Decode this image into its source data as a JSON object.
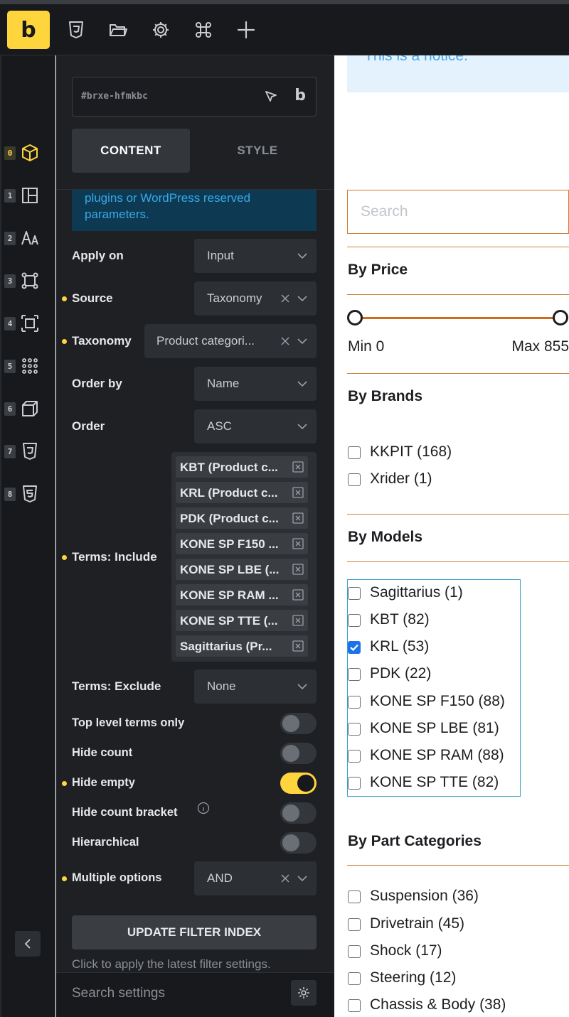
{
  "toolbar": {
    "brand_letter": "b",
    "icons": [
      "css3-icon",
      "folder-icon",
      "gear-icon",
      "command-icon",
      "plus-icon"
    ]
  },
  "rail": {
    "items": [
      {
        "num": "0",
        "icon": "cube-icon",
        "active": true
      },
      {
        "num": "1",
        "icon": "layout-icon",
        "active": false
      },
      {
        "num": "2",
        "icon": "typography-icon",
        "active": false
      },
      {
        "num": "3",
        "icon": "border-icon",
        "active": false
      },
      {
        "num": "4",
        "icon": "spacing-icon",
        "active": false
      },
      {
        "num": "5",
        "icon": "grid-dots-icon",
        "active": false
      },
      {
        "num": "6",
        "icon": "3d-box-icon",
        "active": false
      },
      {
        "num": "7",
        "icon": "css3-icon",
        "active": false
      },
      {
        "num": "8",
        "icon": "html5-icon",
        "active": false
      }
    ]
  },
  "panel": {
    "element_id": "#brxe-hfmkbc",
    "tabs": {
      "content": "CONTENT",
      "style": "STYLE"
    },
    "notice": "plugins or WordPress reserved parameters.",
    "fields": {
      "apply_on": {
        "label": "Apply on",
        "value": "Input"
      },
      "source": {
        "label": "Source",
        "value": "Taxonomy"
      },
      "taxonomy": {
        "label": "Taxonomy",
        "value": "Product categori..."
      },
      "order_by": {
        "label": "Order by",
        "value": "Name"
      },
      "order": {
        "label": "Order",
        "value": "ASC"
      },
      "terms_include": {
        "label": "Terms: Include",
        "tags": [
          "KBT (Product c...",
          "KRL (Product c...",
          "PDK (Product c...",
          "KONE SP F150 ...",
          "KONE SP LBE (...",
          "KONE SP RAM ...",
          "KONE SP TTE (...",
          "Sagittarius (Pr..."
        ]
      },
      "terms_exclude": {
        "label": "Terms: Exclude",
        "value": "None"
      },
      "top_level": {
        "label": "Top level terms only",
        "on": false
      },
      "hide_count": {
        "label": "Hide count",
        "on": false
      },
      "hide_empty": {
        "label": "Hide empty",
        "on": true
      },
      "hide_count_bracket": {
        "label": "Hide count bracket",
        "on": false
      },
      "hierarchical": {
        "label": "Hierarchical",
        "on": false
      },
      "multiple_options": {
        "label": "Multiple options",
        "value": "AND"
      }
    },
    "update_button": "UPDATE FILTER INDEX",
    "update_hint": "Click to apply the latest filter settings.",
    "search_settings_placeholder": "Search settings"
  },
  "canvas": {
    "notice": "This is a notice.",
    "search_placeholder": "Search",
    "price": {
      "title": "By Price",
      "min_label": "Min 0",
      "max_label": "Max 855",
      "min": 0,
      "max": 855
    },
    "brands": {
      "title": "By Brands",
      "items": [
        {
          "label": "KKPIT (168)",
          "checked": false
        },
        {
          "label": "Xrider (1)",
          "checked": false
        }
      ]
    },
    "models": {
      "title": "By Models",
      "items": [
        {
          "label": "Sagittarius (1)",
          "checked": false
        },
        {
          "label": "KBT (82)",
          "checked": false
        },
        {
          "label": "KRL (53)",
          "checked": true
        },
        {
          "label": "PDK (22)",
          "checked": false
        },
        {
          "label": "KONE SP F150 (88)",
          "checked": false
        },
        {
          "label": "KONE SP LBE (81)",
          "checked": false
        },
        {
          "label": "KONE SP RAM (88)",
          "checked": false
        },
        {
          "label": "KONE SP TTE (82)",
          "checked": false
        }
      ]
    },
    "parts": {
      "title": "By Part Categories",
      "items": [
        {
          "label": "Suspension (36)",
          "checked": false
        },
        {
          "label": "Drivetrain (45)",
          "checked": false
        },
        {
          "label": "Shock (17)",
          "checked": false
        },
        {
          "label": "Steering (12)",
          "checked": false
        },
        {
          "label": "Chassis & Body (38)",
          "checked": false
        }
      ]
    }
  },
  "colors": {
    "accent": "#ffd53e",
    "panel_bg": "#1e2024",
    "filter_line": "#c8843e",
    "slider": "#d2691e",
    "notice_bg": "#e4f2fd"
  }
}
